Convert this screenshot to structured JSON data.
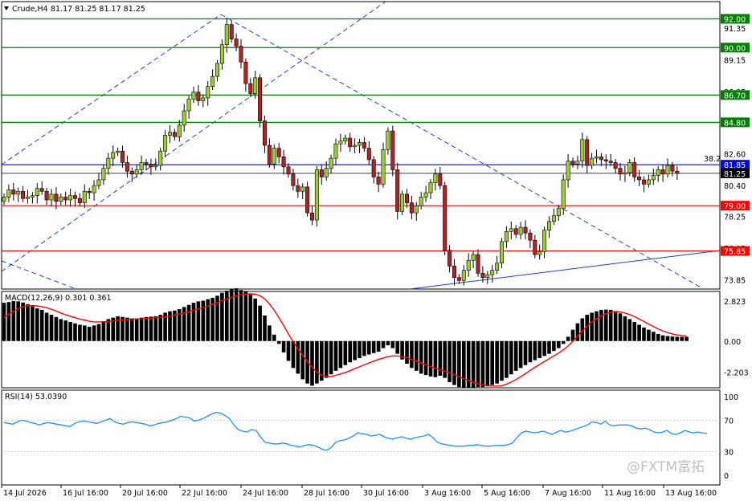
{
  "header": {
    "symbol_timeframe": "Crude,H4",
    "ohlc": "81.17 81.25 81.17 81.25",
    "menu_icon": "triangle-down-icon"
  },
  "chart_data": [
    {
      "type": "candlestick",
      "axis_ticks": [
        "91.35",
        "89.15",
        "86.95",
        "84.80",
        "82.60",
        "80.40",
        "78.25",
        "76.05",
        "73.85"
      ],
      "x_labels": [
        "14 Jul 2026",
        "16 Jul 16:00",
        "20 Jul 16:00",
        "22 Jul 16:00",
        "24 Jul 16:00",
        "28 Jul 16:00",
        "30 Jul 16:00",
        "3 Aug 16:00",
        "5 Aug 16:00",
        "7 Aug 16:00",
        "11 Aug 16:00",
        "13 Aug 16:00"
      ],
      "ylim": [
        73.2,
        93.2
      ],
      "levels": [
        {
          "value": 92.0,
          "label": "92.00",
          "color": "#008000"
        },
        {
          "value": 90.0,
          "label": "90.00",
          "color": "#008000"
        },
        {
          "value": 86.7,
          "label": "86.70",
          "color": "#008000"
        },
        {
          "value": 84.8,
          "label": "84.80",
          "color": "#008000"
        },
        {
          "value": 81.85,
          "label": "81.85",
          "color": "#0000ff"
        },
        {
          "value": 79.0,
          "label": "79.00",
          "color": "#ff0000"
        },
        {
          "value": 75.85,
          "label": "75.85",
          "color": "#ff0000"
        }
      ],
      "current_price": {
        "value": 81.25,
        "label": "81.25"
      },
      "fib_annotation": "38.2",
      "up_color": "#9acd32",
      "down_color": "#b22222",
      "closes": [
        79.6,
        80.1,
        79.8,
        80.0,
        79.5,
        79.6,
        79.7,
        80.2,
        80.0,
        79.4,
        79.8,
        79.3,
        79.6,
        79.4,
        79.7,
        79.5,
        79.2,
        80.0,
        79.9,
        80.4,
        80.8,
        81.6,
        82.3,
        82.7,
        82.8,
        82.0,
        81.4,
        81.2,
        81.5,
        82.0,
        81.9,
        81.7,
        81.8,
        82.8,
        83.9,
        84.1,
        83.8,
        84.6,
        85.6,
        86.4,
        86.9,
        86.3,
        86.5,
        87.3,
        88.0,
        88.9,
        90.2,
        91.6,
        90.6,
        90.1,
        89.0,
        87.5,
        86.8,
        87.9,
        84.9,
        83.2,
        81.9,
        83.0,
        82.4,
        81.7,
        81.2,
        80.4,
        80.0,
        80.3,
        78.5,
        78.0,
        81.5,
        81.0,
        81.6,
        82.3,
        83.3,
        83.5,
        83.7,
        83.1,
        83.2,
        83.4,
        83.0,
        82.2,
        81.0,
        80.5,
        82.9,
        84.2,
        81.5,
        78.6,
        79.8,
        79.2,
        78.5,
        79.0,
        79.6,
        79.9,
        80.6,
        81.2,
        80.4,
        75.9,
        74.8,
        74.0,
        73.8,
        74.5,
        75.2,
        75.6,
        74.3,
        74.0,
        74.2,
        74.5,
        75.0,
        76.5,
        77.2,
        77.4,
        77.0,
        77.5,
        77.1,
        76.6,
        75.6,
        75.8,
        77.3,
        77.9,
        78.3,
        78.8,
        80.8,
        82.1,
        81.9,
        82.1,
        83.6,
        81.8,
        82.3,
        82.4,
        82.2,
        82.1,
        82.0,
        81.6,
        81.2,
        81.3,
        82.0,
        81.0,
        80.8,
        80.5,
        80.8,
        81.1,
        81.5,
        81.2,
        81.8,
        81.4,
        81.25
      ]
    },
    {
      "type": "bar",
      "title": "MACD(12,26,9) 0.301 0.361",
      "axis_ticks": [
        "2.823",
        "0.00",
        "-2.203"
      ],
      "ylim": [
        -3.3,
        3.5
      ],
      "bar_color": "#000000",
      "signal_color": "#ff0000",
      "histogram": [
        2.7,
        2.75,
        2.82,
        2.8,
        2.72,
        2.6,
        2.45,
        2.3,
        2.2,
        2.0,
        1.85,
        1.7,
        1.55,
        1.45,
        1.35,
        1.25,
        1.15,
        1.1,
        1.0,
        1.1,
        1.2,
        1.4,
        1.55,
        1.65,
        1.75,
        1.7,
        1.65,
        1.6,
        1.6,
        1.65,
        1.7,
        1.72,
        1.75,
        1.85,
        2.0,
        2.1,
        2.15,
        2.25,
        2.4,
        2.55,
        2.7,
        2.8,
        2.85,
        2.95,
        3.05,
        3.2,
        3.4,
        3.55,
        3.65,
        3.72,
        3.6,
        3.5,
        3.3,
        3.0,
        2.5,
        1.8,
        1.1,
        0.45,
        -0.2,
        -0.8,
        -1.4,
        -1.9,
        -2.3,
        -2.7,
        -3.0,
        -3.15,
        -3.0,
        -2.8,
        -2.6,
        -2.35,
        -2.1,
        -1.9,
        -1.7,
        -1.5,
        -1.35,
        -1.2,
        -1.05,
        -0.95,
        -0.85,
        -0.75,
        -0.5,
        -0.3,
        -0.5,
        -0.9,
        -1.3,
        -1.6,
        -1.9,
        -2.1,
        -2.3,
        -2.4,
        -2.5,
        -2.55,
        -2.45,
        -2.6,
        -2.9,
        -3.1,
        -3.25,
        -3.3,
        -3.3,
        -3.3,
        -3.25,
        -3.25,
        -3.2,
        -3.1,
        -3.0,
        -2.8,
        -2.6,
        -2.35,
        -2.1,
        -1.9,
        -1.7,
        -1.5,
        -1.35,
        -1.2,
        -1.05,
        -0.9,
        -0.7,
        -0.5,
        -0.2,
        0.3,
        0.8,
        1.25,
        1.6,
        1.85,
        2.0,
        2.1,
        2.2,
        2.22,
        2.2,
        2.12,
        1.95,
        1.75,
        1.55,
        1.35,
        1.15,
        0.95,
        0.8,
        0.65,
        0.5,
        0.4,
        0.35,
        0.32,
        0.3,
        0.3,
        0.3
      ],
      "signal": [
        1.65,
        1.9,
        2.1,
        2.3,
        2.42,
        2.5,
        2.5,
        2.48,
        2.42,
        2.35,
        2.25,
        2.12,
        1.98,
        1.85,
        1.75,
        1.65,
        1.55,
        1.48,
        1.4,
        1.35,
        1.35,
        1.35,
        1.38,
        1.42,
        1.47,
        1.5,
        1.52,
        1.54,
        1.55,
        1.57,
        1.6,
        1.62,
        1.65,
        1.68,
        1.72,
        1.78,
        1.84,
        1.9,
        1.98,
        2.07,
        2.17,
        2.27,
        2.38,
        2.48,
        2.59,
        2.7,
        2.85,
        2.98,
        3.1,
        3.2,
        3.27,
        3.32,
        3.33,
        3.3,
        3.2,
        2.98,
        2.62,
        2.18,
        1.65,
        1.1,
        0.5,
        -0.05,
        -0.55,
        -1.0,
        -1.45,
        -1.85,
        -2.2,
        -2.4,
        -2.5,
        -2.5,
        -2.42,
        -2.32,
        -2.22,
        -2.1,
        -1.95,
        -1.82,
        -1.68,
        -1.55,
        -1.42,
        -1.3,
        -1.2,
        -1.1,
        -1.05,
        -1.05,
        -1.1,
        -1.18,
        -1.3,
        -1.42,
        -1.55,
        -1.68,
        -1.8,
        -1.92,
        -2.02,
        -2.12,
        -2.24,
        -2.36,
        -2.5,
        -2.65,
        -2.78,
        -2.9,
        -3.0,
        -3.08,
        -3.14,
        -3.17,
        -3.18,
        -3.15,
        -3.05,
        -2.9,
        -2.72,
        -2.52,
        -2.3,
        -2.08,
        -1.86,
        -1.65,
        -1.45,
        -1.25,
        -1.05,
        -0.85,
        -0.62,
        -0.35,
        -0.02,
        0.35,
        0.72,
        1.05,
        1.35,
        1.58,
        1.78,
        1.93,
        2.03,
        2.07,
        2.05,
        1.98,
        1.87,
        1.73,
        1.56,
        1.38,
        1.2,
        1.03,
        0.86,
        0.72,
        0.6,
        0.5,
        0.43,
        0.39,
        0.36
      ]
    },
    {
      "type": "line",
      "title": "RSI(14) 53.0390",
      "axis_ticks": [
        "100",
        "70",
        "30",
        "0"
      ],
      "ylim": [
        0,
        100
      ],
      "color": "#1e90ff",
      "levels": [
        70,
        30
      ],
      "values": [
        67,
        66,
        65,
        68,
        70,
        69,
        67,
        66,
        64,
        66,
        67,
        66,
        65,
        64,
        63,
        62,
        66,
        68,
        69,
        68,
        67,
        66,
        68,
        70,
        72,
        68,
        66,
        65,
        67,
        68,
        67,
        66,
        65,
        63,
        64,
        66,
        67,
        68,
        70,
        72,
        75,
        74,
        73,
        69,
        70,
        72,
        75,
        78,
        80,
        79,
        76,
        72,
        64,
        58,
        56,
        55,
        58,
        57,
        49,
        42,
        41,
        40,
        40,
        41,
        40,
        38,
        37,
        36,
        38,
        39,
        38,
        36,
        33,
        32,
        35,
        42,
        44,
        45,
        47,
        50,
        54,
        53,
        52,
        50,
        51,
        52,
        49,
        47,
        46,
        48,
        49,
        47,
        46,
        48,
        49,
        50,
        52,
        48,
        42,
        40,
        39,
        38,
        37,
        37,
        37,
        38,
        38,
        39,
        38,
        37,
        37,
        38,
        38,
        38,
        39,
        41,
        48,
        54,
        56,
        55,
        54,
        55,
        56,
        54,
        52,
        55,
        57,
        55,
        56,
        58,
        60,
        62,
        64,
        68,
        67,
        65,
        69,
        64,
        63,
        64,
        64,
        64,
        63,
        60,
        59,
        60,
        58,
        55,
        54,
        55,
        57,
        53,
        52,
        54,
        57,
        55,
        54,
        55,
        54,
        53.039
      ]
    }
  ],
  "watermark": "@FXTM富拓"
}
